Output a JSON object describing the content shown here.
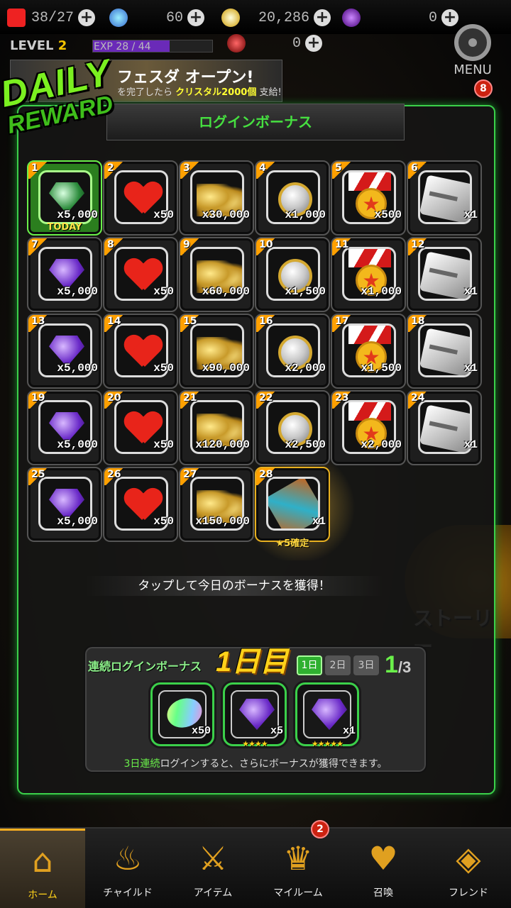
{
  "top": {
    "stamina": "38/27",
    "gems": "60",
    "coins": "20,286",
    "crystal": "0",
    "level_label": "LEVEL",
    "level_value": "2",
    "exp_text": "EXP 28 / 44",
    "exp_progress": 0.64,
    "extra_value": "0",
    "menu_label": "MENU",
    "menu_badge": "8",
    "banner_title": "フェスダ オープン!",
    "banner_sub_pre": "を完了したら ",
    "banner_sub_hl": "クリスタル2000個",
    "banner_sub_post": " 支給!"
  },
  "daily_logo": {
    "line1": "DAILY",
    "line2": "REWARD"
  },
  "panel": {
    "title": "ログインボーナス",
    "today_label": "TODAY",
    "special_label": "★5確定",
    "hint": "タップして今日のボーナスを獲得！",
    "days": [
      {
        "day": "1",
        "item": "gem-green",
        "amount": "x5,000",
        "today": true
      },
      {
        "day": "2",
        "item": "heart",
        "amount": "x50"
      },
      {
        "day": "3",
        "item": "coins",
        "amount": "x30,000"
      },
      {
        "day": "4",
        "item": "coin",
        "amount": "x1,000"
      },
      {
        "day": "5",
        "item": "medal",
        "amount": "x500"
      },
      {
        "day": "6",
        "item": "card",
        "amount": "x1"
      },
      {
        "day": "7",
        "item": "gem",
        "amount": "x5,000"
      },
      {
        "day": "8",
        "item": "heart",
        "amount": "x50"
      },
      {
        "day": "9",
        "item": "coins",
        "amount": "x60,000"
      },
      {
        "day": "10",
        "item": "coin",
        "amount": "x1,500"
      },
      {
        "day": "11",
        "item": "medal",
        "amount": "x1,000"
      },
      {
        "day": "12",
        "item": "card",
        "amount": "x1"
      },
      {
        "day": "13",
        "item": "gem",
        "amount": "x5,000"
      },
      {
        "day": "14",
        "item": "heart",
        "amount": "x50"
      },
      {
        "day": "15",
        "item": "coins",
        "amount": "x90,000"
      },
      {
        "day": "16",
        "item": "coin",
        "amount": "x2,000"
      },
      {
        "day": "17",
        "item": "medal",
        "amount": "x1,500"
      },
      {
        "day": "18",
        "item": "card",
        "amount": "x1"
      },
      {
        "day": "19",
        "item": "gem",
        "amount": "x5,000"
      },
      {
        "day": "20",
        "item": "heart",
        "amount": "x50"
      },
      {
        "day": "21",
        "item": "coins",
        "amount": "x120,000"
      },
      {
        "day": "22",
        "item": "coin",
        "amount": "x2,500"
      },
      {
        "day": "23",
        "item": "medal",
        "amount": "x2,000"
      },
      {
        "day": "24",
        "item": "card",
        "amount": "x1"
      },
      {
        "day": "25",
        "item": "gem",
        "amount": "x5,000"
      },
      {
        "day": "26",
        "item": "heart",
        "amount": "x50"
      },
      {
        "day": "27",
        "item": "coins",
        "amount": "x150,000"
      },
      {
        "day": "28",
        "item": "ticket",
        "amount": "x1",
        "special": true
      }
    ]
  },
  "streak": {
    "title": "連続ログインボーナス",
    "day_label": "1日目",
    "tabs": [
      "1日",
      "2日",
      "3日"
    ],
    "progress": "1",
    "progress_total": "/3",
    "items": [
      {
        "item": "rainbow-gem",
        "amount": "x50",
        "stars": ""
      },
      {
        "item": "gem",
        "amount": "x5",
        "stars": "★★★★"
      },
      {
        "item": "gem",
        "amount": "x1",
        "stars": "★★★★★"
      }
    ],
    "note_hl": "3日連続",
    "note": "ログインすると、さらにボーナスが獲得できます。"
  },
  "story_label": "ストーリー",
  "nav": {
    "items": [
      {
        "label": "ホーム",
        "icon": "home-icon",
        "glyph": "⌂"
      },
      {
        "label": "チャイルド",
        "icon": "flame-icon",
        "glyph": "♨"
      },
      {
        "label": "アイテム",
        "icon": "sword-shield-icon",
        "glyph": "⚔"
      },
      {
        "label": "マイルーム",
        "icon": "crown-icon",
        "glyph": "♛"
      },
      {
        "label": "召喚",
        "icon": "potion-icon",
        "glyph": "♥"
      },
      {
        "label": "フレンド",
        "icon": "shield-icon",
        "glyph": "◈"
      }
    ],
    "badge": "2"
  }
}
